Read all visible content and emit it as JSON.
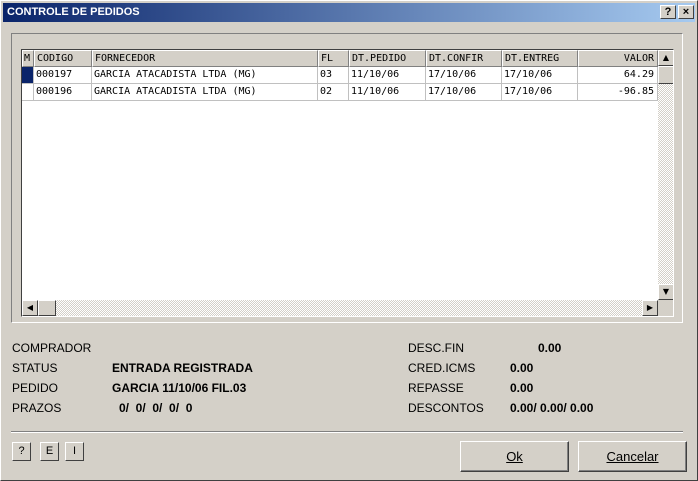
{
  "window": {
    "title": "CONTROLE DE PEDIDOS",
    "help_label": "?",
    "close_label": "×"
  },
  "grid": {
    "columns": [
      "M",
      "CODIGO",
      "FORNECEDOR",
      "FL",
      "DT.PEDIDO",
      "DT.CONFIR",
      "DT.ENTREG",
      "VALOR"
    ],
    "rows": [
      {
        "selected": true,
        "codigo": "000197",
        "fornecedor": "GARCIA ATACADISTA LTDA (MG)",
        "fl": "03",
        "dt_pedido": "11/10/06",
        "dt_confir": "17/10/06",
        "dt_entreg": "17/10/06",
        "valor": "64.29"
      },
      {
        "selected": false,
        "codigo": "000196",
        "fornecedor": "GARCIA ATACADISTA LTDA (MG)",
        "fl": "02",
        "dt_pedido": "11/10/06",
        "dt_confir": "17/10/06",
        "dt_entreg": "17/10/06",
        "valor": "-96.85"
      }
    ]
  },
  "info": {
    "comprador_label": "COMPRADOR",
    "comprador_value": "",
    "status_label": "STATUS",
    "status_value": "ENTRADA REGISTRADA",
    "pedido_label": "PEDIDO",
    "pedido_value": "GARCIA 11/10/06 FIL.03",
    "prazos_label": "PRAZOS",
    "prazos_value": "0/  0/  0/  0/  0",
    "desc_fin_label": "DESC.FIN",
    "desc_fin_value": "0.00",
    "cred_icms_label": "CRED.ICMS",
    "cred_icms_value": "0.00",
    "repasse_label": "REPASSE",
    "repasse_value": "0.00",
    "descontos_label": "DESCONTOS",
    "descontos_value": "0.00/ 0.00/ 0.00"
  },
  "buttons": {
    "help": "?",
    "e": "E",
    "i": "I",
    "ok": "Ok",
    "cancel": "Cancelar"
  }
}
